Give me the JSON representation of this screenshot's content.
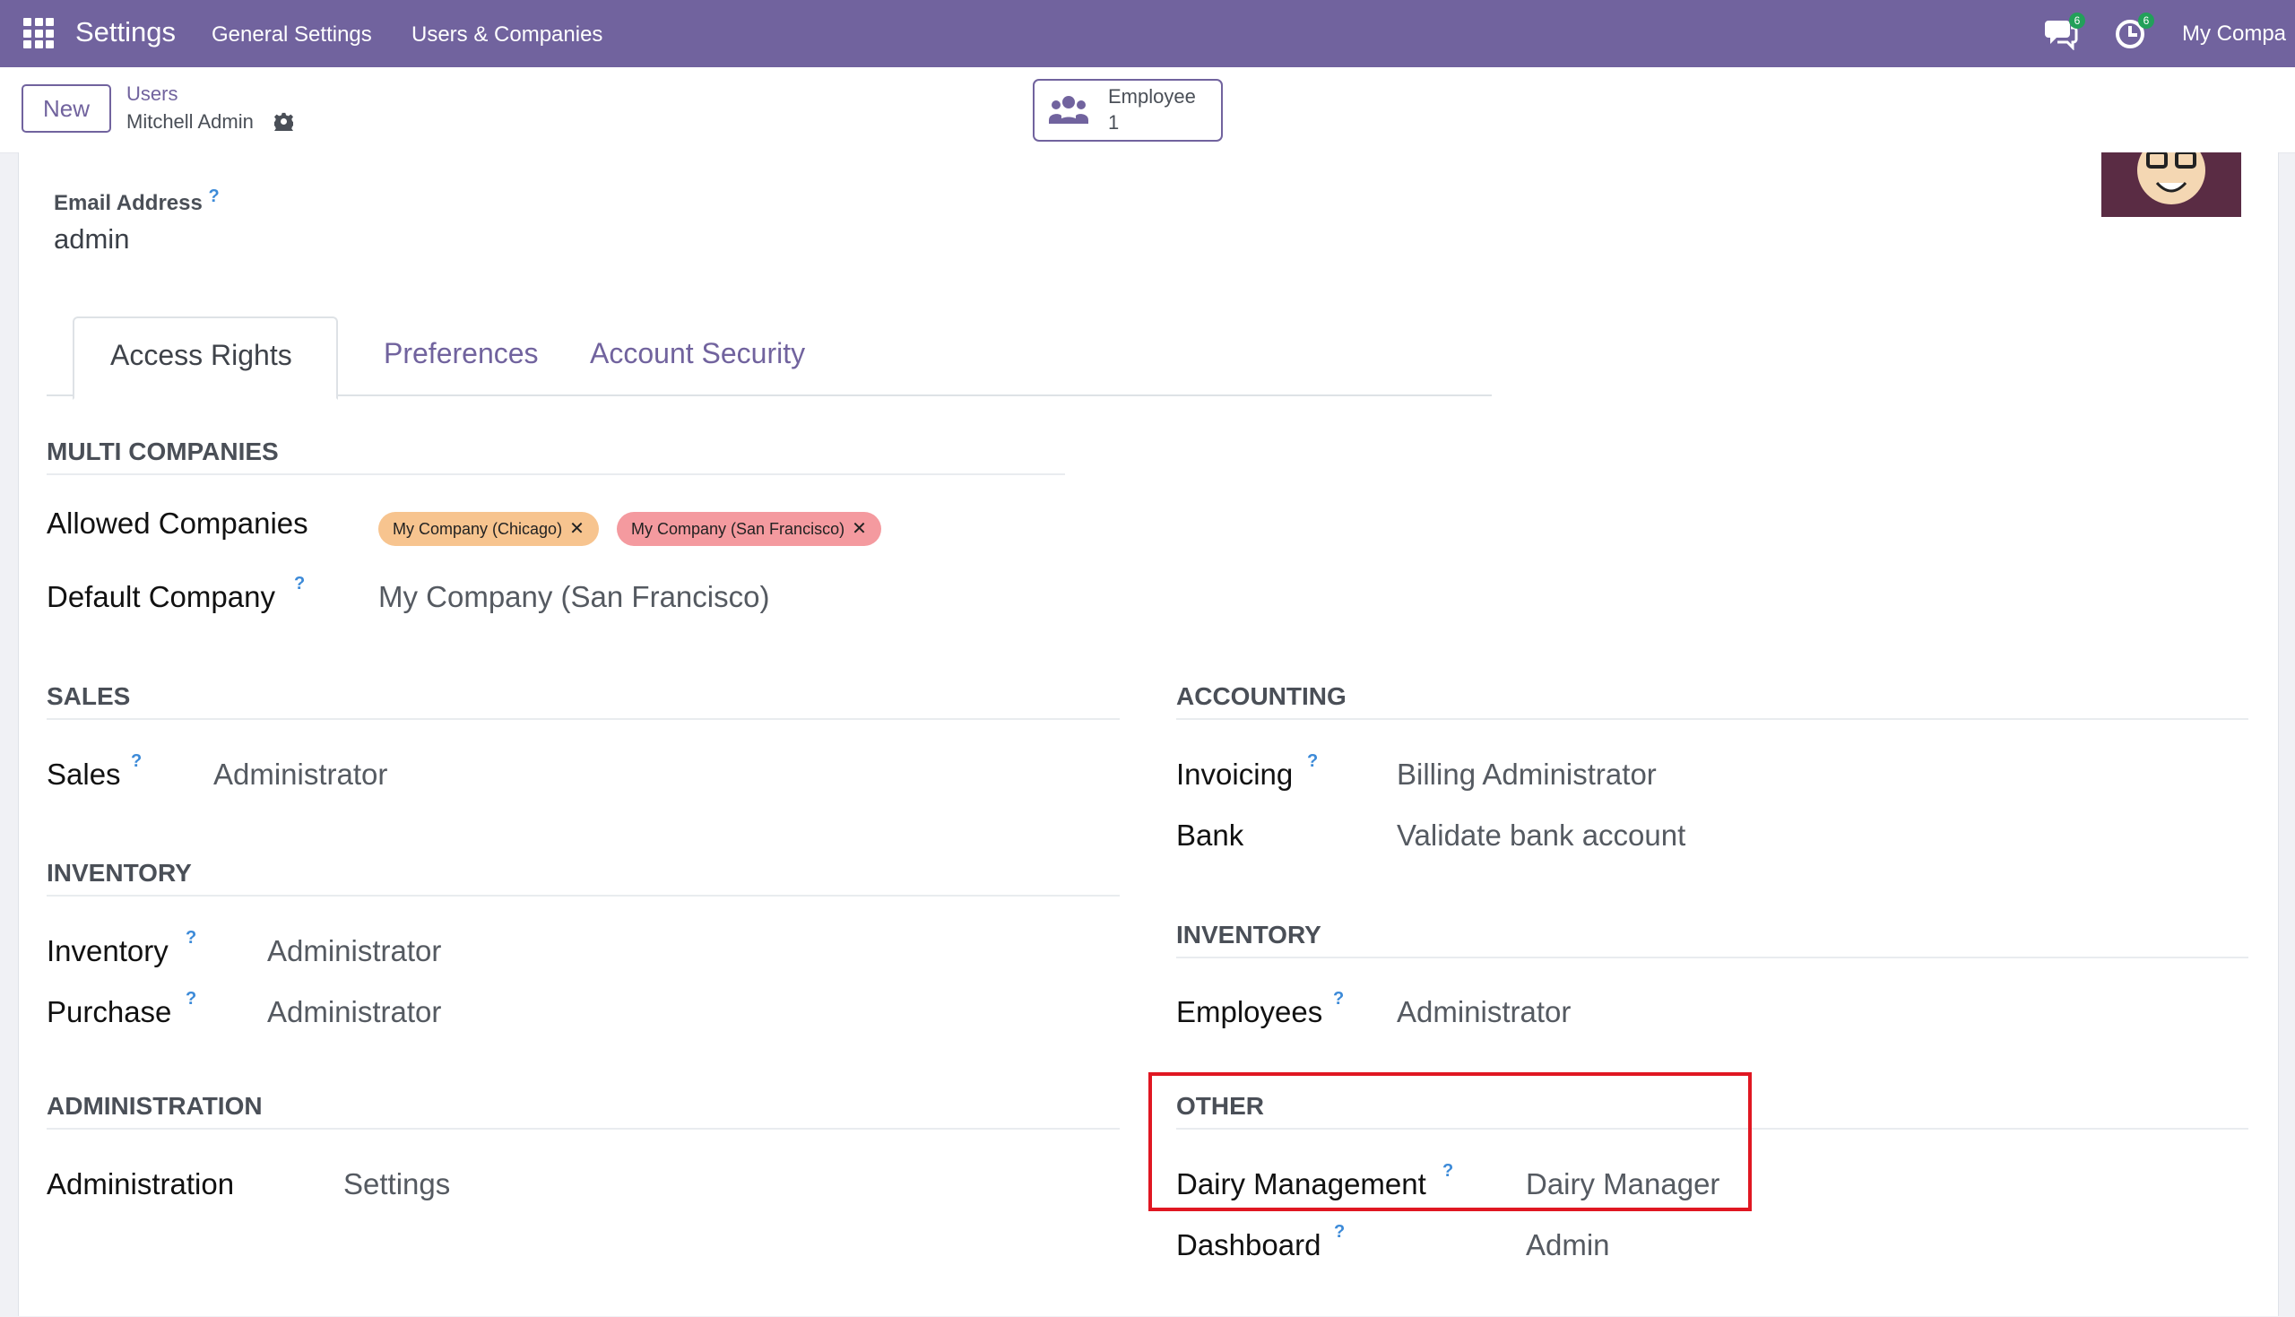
{
  "topbar": {
    "brand": "Settings",
    "menu": [
      "General Settings",
      "Users & Companies"
    ],
    "messages_badge": "6",
    "activities_badge": "6",
    "company": "My Compa"
  },
  "control": {
    "new_button": "New",
    "breadcrumb_parent": "Users",
    "record_name": "Mitchell Admin",
    "employee_label": "Employee",
    "employee_count": "1"
  },
  "form": {
    "email_label": "Email Address",
    "email_help": "?",
    "email_value": "admin",
    "tabs": [
      "Access Rights",
      "Preferences",
      "Account Security"
    ],
    "multi_companies": {
      "title": "MULTI COMPANIES",
      "allowed_label": "Allowed Companies",
      "tags": [
        {
          "label": "My Company (Chicago)",
          "color": "#f7c48f"
        },
        {
          "label": "My Company (San Francisco)",
          "color": "#f49a9f"
        }
      ],
      "default_label": "Default Company",
      "default_help": "?",
      "default_value": "My Company (San Francisco)"
    },
    "sales": {
      "title": "SALES",
      "label": "Sales",
      "help": "?",
      "value": "Administrator"
    },
    "inventory_left": {
      "title": "INVENTORY",
      "rows": [
        {
          "label": "Inventory",
          "help": "?",
          "value": "Administrator"
        },
        {
          "label": "Purchase",
          "help": "?",
          "value": "Administrator"
        }
      ]
    },
    "administration": {
      "title": "ADMINISTRATION",
      "label": "Administration",
      "value": "Settings"
    },
    "accounting": {
      "title": "ACCOUNTING",
      "rows": [
        {
          "label": "Invoicing",
          "help": "?",
          "value": "Billing Administrator"
        },
        {
          "label": "Bank",
          "value": "Validate bank account"
        }
      ]
    },
    "inventory_right": {
      "title": "INVENTORY",
      "label": "Employees",
      "help": "?",
      "value": "Administrator"
    },
    "other": {
      "title": "OTHER",
      "rows": [
        {
          "label": "Dairy Management",
          "help": "?",
          "value": "Dairy Manager"
        },
        {
          "label": "Dashboard",
          "help": "?",
          "value": "Admin"
        }
      ],
      "highlight_color": "#e01722"
    }
  },
  "colors": {
    "brand": "#71639e",
    "background": "#f0f1f5"
  }
}
